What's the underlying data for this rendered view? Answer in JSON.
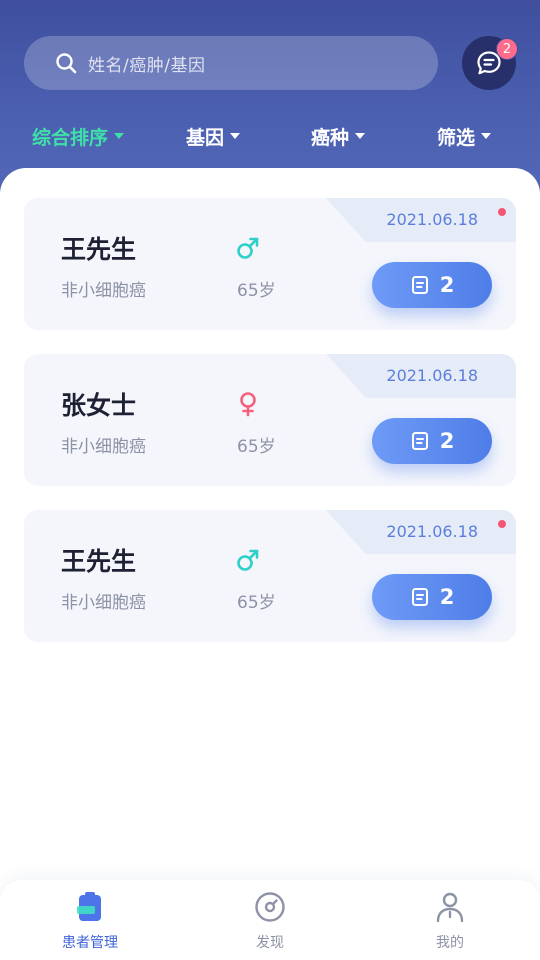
{
  "search": {
    "placeholder": "姓名/癌肿/基因"
  },
  "messages": {
    "badge_count": "2"
  },
  "filters": [
    {
      "label": "综合排序",
      "active": true
    },
    {
      "label": "基因",
      "active": false
    },
    {
      "label": "癌种",
      "active": false
    },
    {
      "label": "筛选",
      "active": false
    }
  ],
  "patients": [
    {
      "name": "王先生",
      "gender": "male",
      "diagnosis": "非小细胞癌",
      "age": "65岁",
      "date": "2021.06.18",
      "records": "2",
      "unread": true
    },
    {
      "name": "张女士",
      "gender": "female",
      "diagnosis": "非小细胞癌",
      "age": "65岁",
      "date": "2021.06.18",
      "records": "2",
      "unread": false
    },
    {
      "name": "王先生",
      "gender": "male",
      "diagnosis": "非小细胞癌",
      "age": "65岁",
      "date": "2021.06.18",
      "records": "2",
      "unread": true
    }
  ],
  "tabbar": [
    {
      "label": "患者管理",
      "icon": "clipboard-icon",
      "active": true
    },
    {
      "label": "发现",
      "icon": "compass-icon",
      "active": false
    },
    {
      "label": "我的",
      "icon": "person-icon",
      "active": false
    }
  ],
  "colors": {
    "header": "#4b5fb0",
    "active_filter": "#3fe0a7",
    "male": "#2fd1c6",
    "female": "#f2627c",
    "accent": "#5680e8",
    "badge": "#ff6b8b"
  }
}
